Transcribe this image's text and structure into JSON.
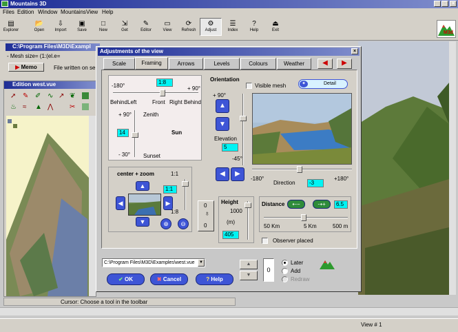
{
  "window": {
    "title": "Mountains 3D"
  },
  "menu": [
    "Files",
    "Edition",
    "Window",
    "Mountains",
    "View",
    "Help"
  ],
  "toolbar": [
    {
      "label": "Explorer",
      "icon": "explorer-icon"
    },
    {
      "label": "Open",
      "icon": "open-icon"
    },
    {
      "label": "Import",
      "icon": "import-icon"
    },
    {
      "label": "Save",
      "icon": "save-icon"
    },
    {
      "label": "New",
      "icon": "new-icon"
    },
    {
      "label": "Get",
      "icon": "get-icon"
    },
    {
      "label": "Editor",
      "icon": "editor-icon"
    },
    {
      "label": "View",
      "icon": "view-icon"
    },
    {
      "label": "Refresh",
      "icon": "refresh-icon"
    },
    {
      "label": "Adjust",
      "icon": "adjust-icon"
    },
    {
      "label": "Index",
      "icon": "index-icon"
    },
    {
      "label": "Help",
      "icon": "help-icon"
    },
    {
      "label": "Exit",
      "icon": "exit-icon"
    }
  ],
  "logo": "M3d",
  "left_panel": {
    "path": "C:\\Program Files\\M3D\\Exampl",
    "mesh_line": "- Mesh size= (1:(el.e=",
    "memo_button": "Memo",
    "file_status": "File written on se",
    "edition_title": "Edition west.vue"
  },
  "dialog": {
    "title": "Adjustments of the view",
    "tabs": [
      "Scale",
      "Framing",
      "Arrows",
      "Levels",
      "Colours",
      "Weather"
    ],
    "active_tab": "Framing",
    "sun": {
      "top_left": "-180°",
      "top_value": "1:8",
      "top_right": "+ 90°",
      "row": [
        "Behind",
        "Left",
        "Front",
        "Right",
        "Behind"
      ],
      "zenith_value": "+ 90°",
      "zenith": "Zenith",
      "value": "14",
      "label": "Sun",
      "sunset_value": "- 30°",
      "sunset": "Sunset"
    },
    "center": {
      "label": "center + zoom",
      "ratio_top": "1:1",
      "zoom_value": "1:1",
      "ratio_bottom": "1:8",
      "stepper_value": "0",
      "stepper_bottom": "0"
    },
    "orientation": {
      "label": "Orientation",
      "visible_mesh": "Visible mesh",
      "detail_button": "Detail",
      "top_angle": "+ 90°",
      "elevation": "Elevation",
      "elevation_value": "5",
      "bottom_angle": "-45°",
      "left_angle": "-180°",
      "direction": "Direction",
      "direction_value": "-3",
      "right_angle": "+180°"
    },
    "height": {
      "label": "Height",
      "value_top": "1000",
      "unit": "(m)",
      "value": "405"
    },
    "distance": {
      "label": "Distance",
      "value": "6.5",
      "min": "50 Km",
      "mid": "5 Km",
      "max": "500 m",
      "observer": "Observer placed"
    },
    "path_field": "C:\\Program Files\\M3D\\Examples\\west.vue",
    "buttons": {
      "ok": "OK",
      "cancel": "Cancel",
      "help": "Help"
    },
    "counter": "0",
    "radios": [
      "Later",
      "Add",
      "Redraw"
    ]
  },
  "status": {
    "cursor": "Cursor: Choose a tool in the toolbar",
    "view": "View # 1"
  }
}
